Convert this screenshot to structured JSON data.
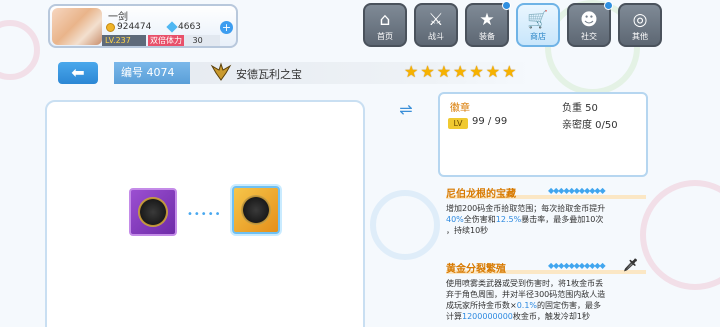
{
  "player": {
    "name": "一剑",
    "gold": "924474",
    "gems": "4663",
    "level": "LV.237",
    "stamina_label": "双倍体力",
    "stamina_value": "30",
    "add": "+"
  },
  "menu": [
    {
      "label": "首页",
      "icon": "house-icon",
      "glyph": "⌂"
    },
    {
      "label": "战斗",
      "icon": "crossed-swords-icon",
      "glyph": "⚔"
    },
    {
      "label": "装备",
      "icon": "star-box-icon",
      "glyph": "★"
    },
    {
      "label": "商店",
      "icon": "shopping-cart-icon",
      "glyph": "🛒"
    },
    {
      "label": "社交",
      "icon": "skull-icon",
      "glyph": "☻"
    },
    {
      "label": "其他",
      "icon": "target-icon",
      "glyph": "◎"
    }
  ],
  "item": {
    "back": "⬅",
    "id_label": "编号 4074",
    "name": "安德瓦利之宝",
    "star_glyph": "★",
    "stars": 7
  },
  "info": {
    "type": "徽章",
    "weight": "负重 50",
    "lv_tag": "LV",
    "level": "99 / 99",
    "intimacy": "亲密度 0/50"
  },
  "icons": {
    "transfer": "⇌",
    "arrow_dots": "•••••",
    "sword": "🗡",
    "gem_row": "◆◆◆◆◆◆◆◆◆◆◆"
  },
  "skills": [
    {
      "title": "尼伯龙根的宝藏",
      "desc_a": "增加200码金币拾取范围；每次拾取金币提升",
      "desc_b1": "40%",
      "desc_b2": "全伤害和",
      "desc_b3": "12.5%",
      "desc_b4": "暴击率，最多叠加10次",
      "desc_c": "，持续10秒"
    },
    {
      "title": "黄金分裂繁殖",
      "desc_a": "使用喷雾类武器或受到伤害时，将1枚金币丢",
      "desc_b": "弃于角色周围，并对半径300码范围内敌人造",
      "desc_c1": "成玩家所持金币数×",
      "desc_c2": "0.1%",
      "desc_c3": "的固定伤害，最多",
      "desc_d1": "计算",
      "desc_d2": "1200000000",
      "desc_d3": "枚金币，触发冷却1秒"
    }
  ],
  "colors": {
    "accent": "#3a9be6",
    "gold_text": "#d87a00",
    "star": "#f6b200"
  }
}
